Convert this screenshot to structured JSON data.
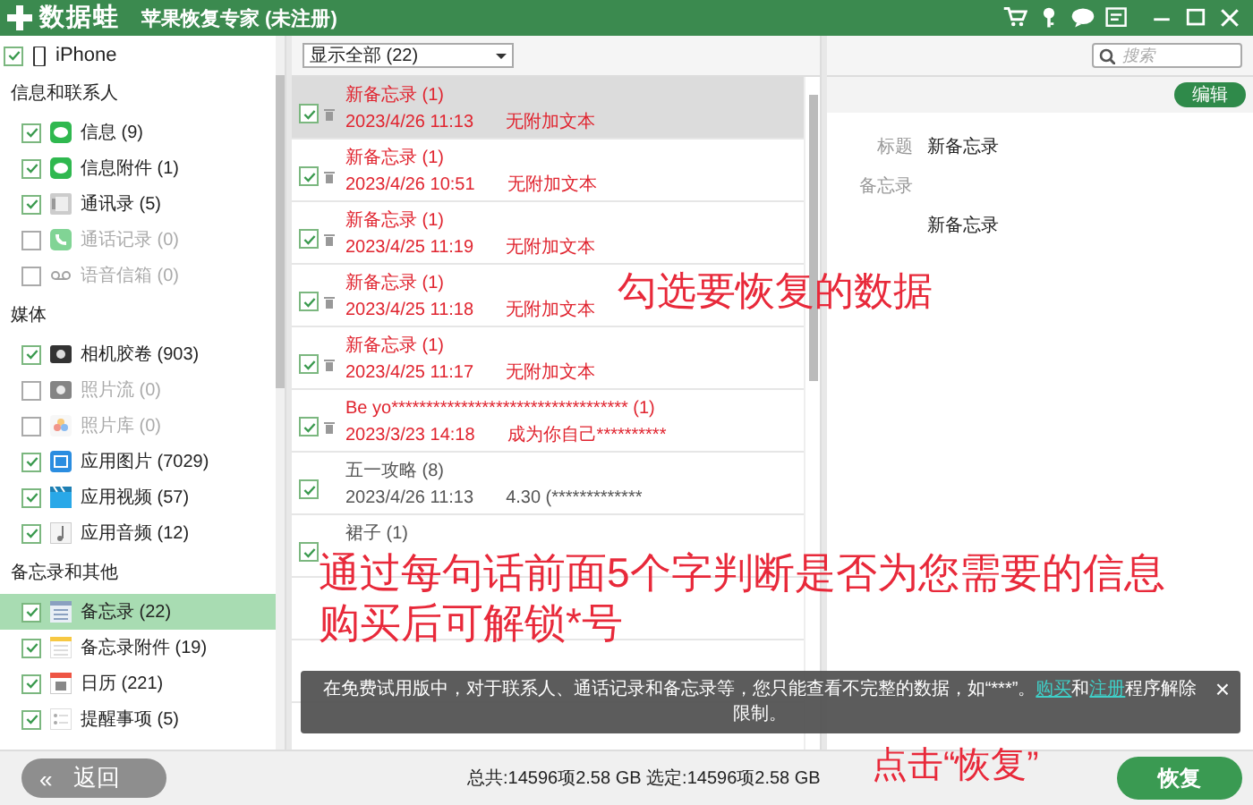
{
  "window": {
    "brand": "数据蛙",
    "title": "苹果恢复专家 (未注册)"
  },
  "sidebar": {
    "device": {
      "label": "iPhone",
      "checked": true
    },
    "groups": [
      {
        "heading": "信息和联系人",
        "items": [
          {
            "kind": "message",
            "label": "信息 (9)",
            "checked": true,
            "disabled": false,
            "selected": false
          },
          {
            "kind": "message",
            "label": "信息附件 (1)",
            "checked": true,
            "disabled": false,
            "selected": false
          },
          {
            "kind": "contacts",
            "label": "通讯录 (5)",
            "checked": true,
            "disabled": false,
            "selected": false
          },
          {
            "kind": "phone",
            "label": "通话记录 (0)",
            "checked": false,
            "disabled": true,
            "selected": false
          },
          {
            "kind": "voicemail",
            "label": "语音信箱 (0)",
            "checked": false,
            "disabled": true,
            "selected": false
          }
        ]
      },
      {
        "heading": "媒体",
        "items": [
          {
            "kind": "camera",
            "label": "相机胶卷 (903)",
            "checked": true,
            "disabled": false,
            "selected": false
          },
          {
            "kind": "camera",
            "label": "照片流 (0)",
            "checked": false,
            "disabled": true,
            "selected": false
          },
          {
            "kind": "photos",
            "label": "照片库 (0)",
            "checked": false,
            "disabled": true,
            "selected": false
          },
          {
            "kind": "image",
            "label": "应用图片 (7029)",
            "checked": true,
            "disabled": false,
            "selected": false
          },
          {
            "kind": "video",
            "label": "应用视频 (57)",
            "checked": true,
            "disabled": false,
            "selected": false
          },
          {
            "kind": "audio",
            "label": "应用音频 (12)",
            "checked": true,
            "disabled": false,
            "selected": false
          }
        ]
      },
      {
        "heading": "备忘录和其他",
        "items": [
          {
            "kind": "notes",
            "label": "备忘录 (22)",
            "checked": true,
            "disabled": false,
            "selected": true
          },
          {
            "kind": "noteattach",
            "label": "备忘录附件 (19)",
            "checked": true,
            "disabled": false,
            "selected": false
          },
          {
            "kind": "calendar",
            "label": "日历 (221)",
            "checked": true,
            "disabled": false,
            "selected": false
          },
          {
            "kind": "reminder",
            "label": "提醒事项 (5)",
            "checked": true,
            "disabled": false,
            "selected": false
          }
        ]
      }
    ]
  },
  "filter": {
    "value": "显示全部 (22)"
  },
  "search": {
    "placeholder": "搜索"
  },
  "notes_list": [
    {
      "title": "新备忘录 (1)",
      "date": "2023/4/26 11:13",
      "snippet": "无附加文本",
      "checked": true,
      "deleted": true,
      "selected": true
    },
    {
      "title": "新备忘录 (1)",
      "date": "2023/4/26 10:51",
      "snippet": "无附加文本",
      "checked": true,
      "deleted": true,
      "selected": false
    },
    {
      "title": "新备忘录 (1)",
      "date": "2023/4/25 11:19",
      "snippet": "无附加文本",
      "checked": true,
      "deleted": true,
      "selected": false
    },
    {
      "title": "新备忘录 (1)",
      "date": "2023/4/25 11:18",
      "snippet": "无附加文本",
      "checked": true,
      "deleted": true,
      "selected": false
    },
    {
      "title": "新备忘录 (1)",
      "date": "2023/4/25 11:17",
      "snippet": "无附加文本",
      "checked": true,
      "deleted": true,
      "selected": false
    },
    {
      "title": "Be yo********************************** (1)",
      "date": "2023/3/23 14:18",
      "snippet": "成为你自己**********",
      "checked": true,
      "deleted": true,
      "selected": false
    },
    {
      "title": "五一攻略 (8)",
      "date": "2023/4/26 11:13",
      "snippet": "4.30  (*************",
      "checked": true,
      "deleted": false,
      "selected": false
    },
    {
      "title": "裙子 (1)",
      "checked": true,
      "deleted": false,
      "selected": false
    }
  ],
  "detail": {
    "edit_button": "编辑",
    "fields": [
      {
        "label": "标题",
        "value": "新备忘录"
      },
      {
        "label": "备忘录",
        "value": "新备忘录"
      }
    ]
  },
  "annotations": [
    "勾选要恢复的数据",
    "通过每句话前面5个字判断是否为您需要的信息",
    "购买后可解锁*号",
    "点击“恢复”"
  ],
  "toast": {
    "before": "在免费试用版中，对于联系人、通话记录和备忘录等，您只能查看不完整的数据，如“***”。",
    "link_1": "购买",
    "middle": "和",
    "link_2": "注册",
    "after": "程序解除限制。",
    "close": "×"
  },
  "footer": {
    "back_icon": "«",
    "back": "返回",
    "status": "总共:14596项2.58 GB 选定:14596项2.58 GB",
    "recover": "恢复"
  }
}
